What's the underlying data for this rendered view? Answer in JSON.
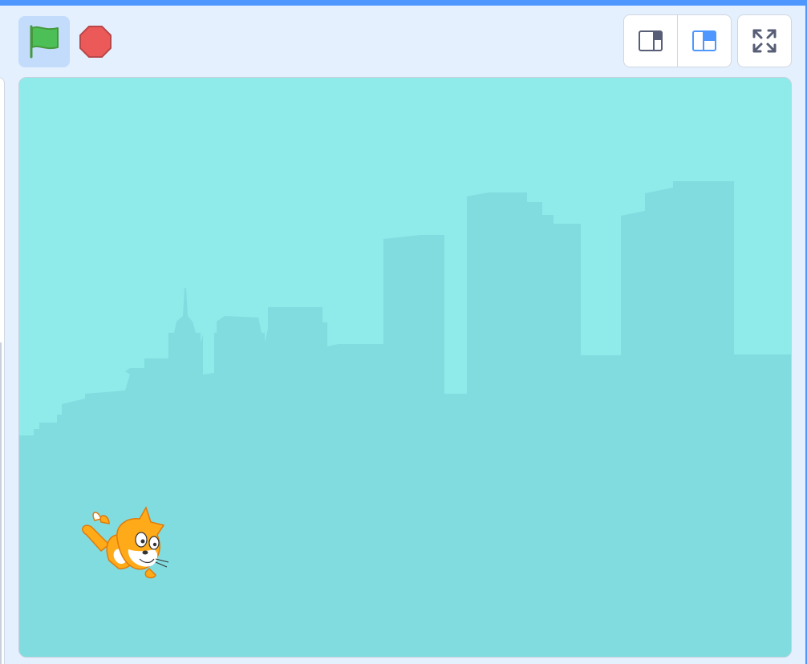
{
  "toolbar": {
    "green_flag": {
      "icon": "green-flag-icon",
      "color": "#4cbf56"
    },
    "stop": {
      "icon": "stop-icon",
      "color": "#ec5959"
    },
    "small_stage_mode": {
      "icon": "small-stage-icon"
    },
    "normal_stage_mode": {
      "icon": "normal-stage-icon",
      "selected": true,
      "accent": "#4d97ff"
    },
    "fullscreen": {
      "icon": "fullscreen-icon"
    }
  },
  "stage": {
    "backdrop": "city-skyline",
    "sky_color": "#8eebea",
    "building_color": "#80dcdf",
    "sprite": "cat-sprite"
  }
}
